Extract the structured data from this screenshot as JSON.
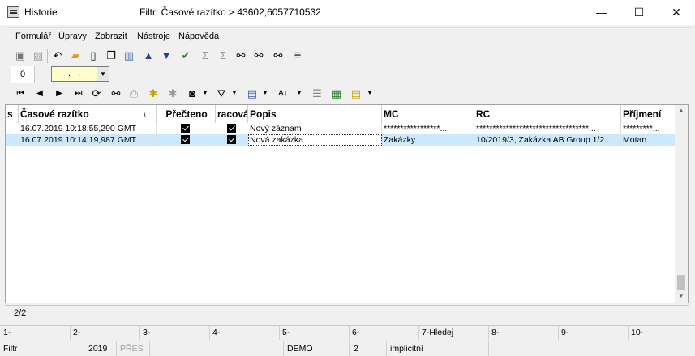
{
  "window": {
    "title": "Historie",
    "filter_label": "Filtr: Časové razítko > 43602,6057710532",
    "minimize": "—",
    "maximize": "☐",
    "close": "✕"
  },
  "menu": [
    {
      "pre": "",
      "u": "F",
      "post": "ormulář"
    },
    {
      "pre": "",
      "u": "Ú",
      "post": "pravy"
    },
    {
      "pre": "",
      "u": "Z",
      "post": "obrazit"
    },
    {
      "pre": "",
      "u": "N",
      "post": "ástroje"
    },
    {
      "pre": "Nápo",
      "u": "v",
      "post": "ěda"
    }
  ],
  "tabs": {
    "tab0": "0",
    "combo_value": ". ."
  },
  "grid": {
    "headers": [
      "s",
      "Časové razítko",
      "Přečteno",
      "racová",
      "Popis",
      "MC",
      "RC",
      "Příjmení"
    ],
    "sort_indicator": "\\",
    "rows": [
      {
        "timestamp": "16.07.2019 10:18:55,290 GMT",
        "popis": "Nový záznam",
        "mc": "*****************...",
        "rc": "**********************************...",
        "prijmeni": "*********..."
      },
      {
        "timestamp": "16.07.2019 10:14:19,987 GMT",
        "popis": "Nová zakázka",
        "mc": "Zakázky",
        "rc": "10/2019/3, Zakázka AB Group 1/2...",
        "prijmeni": "Motan"
      }
    ]
  },
  "record_count": "2/2",
  "fkeys": [
    "1-",
    "2-",
    "3-",
    "4-",
    "5-",
    "6-",
    "7-Hledej",
    "8-",
    "9-",
    "10-"
  ],
  "status": {
    "mode": "Filtr",
    "year": "2019",
    "overwrite": "PŘES",
    "db": "DEMO",
    "num": "2",
    "profile": "implicitní"
  }
}
